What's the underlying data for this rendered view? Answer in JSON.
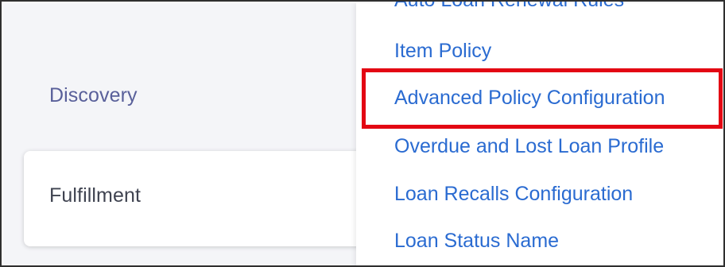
{
  "left_menu": {
    "discovery_label": "Discovery",
    "fulfillment_label": "Fulfillment"
  },
  "submenu": {
    "items": [
      {
        "label": "Auto Loan Renewal Rules"
      },
      {
        "label": "Item Policy"
      },
      {
        "label": "Advanced Policy Configuration"
      },
      {
        "label": "Overdue and Lost Loan Profile"
      },
      {
        "label": "Loan Recalls Configuration"
      },
      {
        "label": "Loan Status Name"
      }
    ]
  },
  "colors": {
    "link": "#2a6bd1",
    "highlight": "#e30613"
  }
}
